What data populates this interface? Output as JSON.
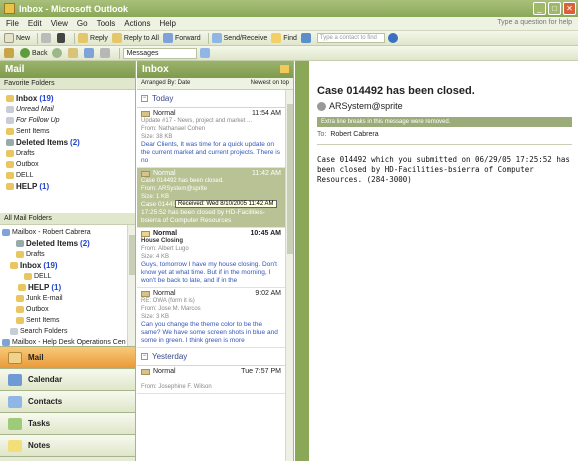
{
  "window": {
    "title": "Inbox - Microsoft Outlook"
  },
  "menu": {
    "items": [
      "File",
      "Edit",
      "View",
      "Go",
      "Tools",
      "Actions",
      "Help"
    ],
    "help_placeholder": "Type a question for help"
  },
  "toolbar1": {
    "new": "New",
    "reply": "Reply",
    "reply_all": "Reply to All",
    "forward": "Forward",
    "send_receive": "Send/Receive",
    "find": "Find",
    "contact_placeholder": "Type a contact to find"
  },
  "toolbar2": {
    "back": "Back",
    "messages_combo": "Messages"
  },
  "nav": {
    "header": "Mail",
    "favorites_label": "Favorite Folders",
    "favorites": [
      {
        "label": "Inbox",
        "count": "(19)"
      },
      {
        "label": "Unread Mail",
        "count": ""
      },
      {
        "label": "For Follow Up",
        "count": ""
      },
      {
        "label": "Sent Items",
        "count": ""
      },
      {
        "label": "Deleted Items",
        "count": "(2)"
      },
      {
        "label": "Drafts",
        "count": ""
      },
      {
        "label": "Outbox",
        "count": ""
      },
      {
        "label": "DELL",
        "count": ""
      },
      {
        "label": "HELP",
        "count": "(1)"
      }
    ],
    "all_folders_label": "All Mail Folders",
    "tree": [
      {
        "label": "Mailbox - Robert Cabrera",
        "count": ""
      },
      {
        "label": "Deleted Items",
        "count": "(2)"
      },
      {
        "label": "Drafts",
        "count": ""
      },
      {
        "label": "Inbox",
        "count": "(19)"
      },
      {
        "label": "DELL",
        "count": ""
      },
      {
        "label": "HELP",
        "count": "(1)"
      },
      {
        "label": "Junk E-mail",
        "count": ""
      },
      {
        "label": "Outbox",
        "count": ""
      },
      {
        "label": "Sent Items",
        "count": ""
      },
      {
        "label": "Search Folders",
        "count": ""
      },
      {
        "label": "Mailbox - Help Desk Operations Cen",
        "count": ""
      }
    ],
    "buttons": [
      "Mail",
      "Calendar",
      "Contacts",
      "Tasks",
      "Notes"
    ]
  },
  "inbox": {
    "header": "Inbox",
    "arranged_by": "Arranged By: Date",
    "sort": "Newest on top",
    "group_today": "Today",
    "group_yesterday": "Yesterday",
    "messages": [
      {
        "importance": "Normal",
        "time": "11:54 AM",
        "lines": [
          "Update #17 - News, project and market ...",
          "From: Nathanael Cohen",
          "Size: 38 KB"
        ],
        "body": "Dear Clients, It was time for a quick update on the current market and current projects. There is no"
      },
      {
        "importance": "Normal",
        "time": "11:42 AM",
        "lines": [
          "Case 014492 has been closed.",
          "From: ARSystem@sprite",
          "Size: 1 KB"
        ],
        "body": "Case 014492 which you submitted on 06/29/05 17:25:52 has been closed by HD-Facilities-bsierra of Computer Resources"
      },
      {
        "importance": "Normal",
        "time": "10:45 AM",
        "lines": [
          "House Closing",
          "From: Albert Lugo",
          "Size: 4 KB"
        ],
        "body": "Guys, tomorrow I have my house closing. Don't know yet at what time. But if in the morning, I won't be back to late, and if in the"
      },
      {
        "importance": "Normal",
        "time": "9:02 AM",
        "lines": [
          "RE: OWA (form it is)",
          "From: Jose M. Marcos",
          "Size: 3 KB"
        ],
        "body": "Can you change the theme color to be the same? We have some screen shots in blue and some in green. I think green is more"
      },
      {
        "importance": "Normal",
        "time": "Tue 7:57 PM",
        "lines": [
          "",
          "From: Josephine F. Wilson",
          ""
        ],
        "body": ""
      }
    ],
    "tooltip": "Received: Wed 8/10/2005 11:42 AM"
  },
  "reading": {
    "subject": "Case 014492 has been closed.",
    "from": "ARSystem@sprite",
    "info": "Extra line breaks in this message were removed.",
    "to_label": "To:",
    "to": "Robert Cabrera",
    "body": "Case 014492 which you submitted on 06/29/05 17:25:52 has\nbeen closed by HD-Facilities-bsierra of Computer\nResources. (284-3000)"
  },
  "colors": {
    "accent": "#8aa858",
    "selected_row": "#b8c294",
    "active_nav": "#e99a37"
  }
}
